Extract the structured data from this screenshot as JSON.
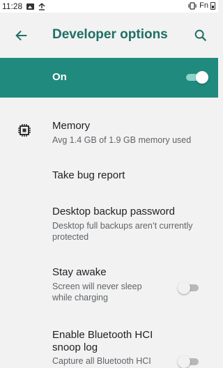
{
  "status_bar": {
    "time": "11:28",
    "icons": [
      "image-icon",
      "upload-icon"
    ],
    "right_text": "Fn"
  },
  "app_bar": {
    "title": "Developer options",
    "back_icon": "arrow-back-icon",
    "search_icon": "search-icon"
  },
  "master_switch": {
    "label": "On",
    "enabled": true
  },
  "items": [
    {
      "title": "Memory",
      "summary": "Avg 1.4 GB of 1.9 GB memory used",
      "icon": "memory-chip-icon"
    },
    {
      "title": "Take bug report"
    },
    {
      "title": "Desktop backup password",
      "summary_line1": "Desktop full backups aren’t currently",
      "summary_line2": "protected"
    },
    {
      "title": "Stay awake",
      "summary_line1": "Screen will never sleep",
      "summary_line2": "while charging",
      "enabled": false
    },
    {
      "title_line1": "Enable Bluetooth HCI",
      "title_line2": "snoop log",
      "summary_line1": "Capture all Bluetooth HCI",
      "enabled": false
    }
  ],
  "colors": {
    "accent": "#1f6f66",
    "master_background": "#1f8a7d",
    "background": "#f2f2f2"
  }
}
